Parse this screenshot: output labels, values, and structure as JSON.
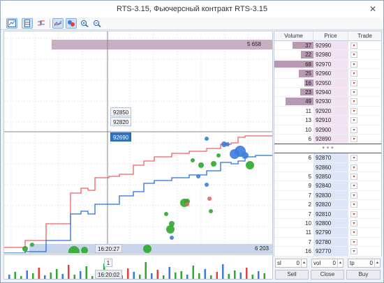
{
  "window": {
    "title": "RTS-3.15, Фьючерсный контракт RTS-3.15"
  },
  "toolbar": {
    "icons": [
      "chart-mode-icon",
      "dom-icon",
      "ticks-icon",
      "trades-icon",
      "bubbles-icon",
      "zoom-in-icon",
      "zoom-out-icon"
    ]
  },
  "chart": {
    "top_volume_label": "5 658",
    "bottom_volume_label": "6 203",
    "price_labels": [
      "92850",
      "92820",
      "92690"
    ],
    "time_label_main": "16:20:27",
    "time_label_sub": "16:20:02",
    "scroll_marker": "1",
    "ask_volume_level": 1.0,
    "bid_volume_level": 1.0
  },
  "dom": {
    "headers": {
      "volume": "Volume",
      "price": "Price",
      "trade": "Trade"
    },
    "asks": [
      {
        "vol": "37",
        "price": "92990",
        "level": 0.54
      },
      {
        "vol": "22",
        "price": "92980",
        "level": 0.32
      },
      {
        "vol": "68",
        "price": "92970",
        "level": 1.0
      },
      {
        "vol": "25",
        "price": "92960",
        "level": 0.37
      },
      {
        "vol": "16",
        "price": "92950",
        "level": 0.24
      },
      {
        "vol": "23",
        "price": "92940",
        "level": 0.34
      },
      {
        "vol": "49",
        "price": "92930",
        "level": 0.72
      },
      {
        "vol": "11",
        "price": "92920",
        "level": 0.0
      },
      {
        "vol": "13",
        "price": "92910",
        "level": 0.0
      },
      {
        "vol": "10",
        "price": "92900",
        "level": 0.0
      },
      {
        "vol": "6",
        "price": "92890",
        "level": 0.0
      }
    ],
    "separator": "• • •",
    "bids": [
      {
        "vol": "6",
        "price": "92870",
        "level": 0.0
      },
      {
        "vol": "",
        "price": "92860",
        "level": 0.0
      },
      {
        "vol": "5",
        "price": "92850",
        "level": 0.0
      },
      {
        "vol": "9",
        "price": "92840",
        "level": 0.0
      },
      {
        "vol": "7",
        "price": "92830",
        "level": 0.0
      },
      {
        "vol": "2",
        "price": "92820",
        "level": 0.0
      },
      {
        "vol": "7",
        "price": "92810",
        "level": 0.0
      },
      {
        "vol": "10",
        "price": "92800",
        "level": 0.0
      },
      {
        "vol": "11",
        "price": "92790",
        "level": 0.0
      },
      {
        "vol": "7",
        "price": "92780",
        "level": 0.0
      },
      {
        "vol": "16",
        "price": "92770",
        "level": 0.0
      }
    ],
    "arrow_glyph": "▾"
  },
  "trade_panel": {
    "sl_label": "sl",
    "sl_value": "0",
    "vol_label": "vol",
    "vol_value": "0",
    "tp_label": "tp",
    "tp_value": "0",
    "sell": "Sell",
    "close": "Close",
    "buy": "Buy"
  },
  "colors": {
    "ask_line": "#f06060",
    "bid_line": "#2a6fd6",
    "buy_bubble": "#3b7be0",
    "sell_bubble": "#2ea82e",
    "ask_bar": "#b998b3",
    "bid_bar": "#9db4dc"
  }
}
